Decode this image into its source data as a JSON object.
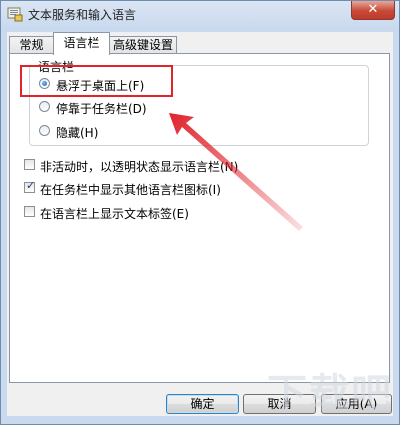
{
  "window": {
    "title": "文本服务和输入语言",
    "close_label": "✕"
  },
  "tabs": [
    {
      "label": "常规",
      "active": false
    },
    {
      "label": "语言栏",
      "active": true
    },
    {
      "label": "高级键设置",
      "active": false
    }
  ],
  "language_bar": {
    "group_label": "语言栏",
    "options": [
      {
        "label": "悬浮于桌面上(F)",
        "checked": true
      },
      {
        "label": "停靠于任务栏(D)",
        "checked": false
      },
      {
        "label": "隐藏(H)",
        "checked": false
      }
    ]
  },
  "checkboxes": [
    {
      "label": "非活动时，以透明状态显示语言栏(N)",
      "checked": false
    },
    {
      "label": "在任务栏中显示其他语言栏图标(I)",
      "checked": true
    },
    {
      "label": "在语言栏上显示文本标签(E)",
      "checked": false
    }
  ],
  "buttons": {
    "ok": "确定",
    "cancel": "取消",
    "apply": "应用(A)"
  },
  "watermark": "下载吧",
  "colors": {
    "annotation_red": "#e0242c",
    "title_bar": "#c9d9ee"
  }
}
